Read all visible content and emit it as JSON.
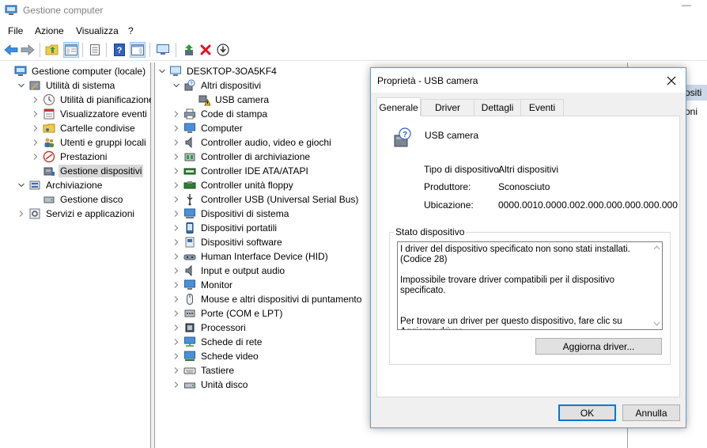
{
  "window": {
    "title": "Gestione computer",
    "minimize_glyph": "—"
  },
  "menu": [
    "File",
    "Azione",
    "Visualizza",
    "?"
  ],
  "toolbar_icons": [
    "back-arrow-icon",
    "forward-arrow-icon",
    "up-folder-icon",
    "show-hide-tree-icon",
    "properties-icon",
    "help-icon",
    "action-pane-icon",
    "monitor-icon",
    "update-driver-icon",
    "uninstall-icon",
    "download-icon"
  ],
  "left_tree": [
    {
      "label": "Gestione computer (locale)",
      "level": 0,
      "arrow": "none",
      "icon": "computer-management-icon"
    },
    {
      "label": "Utilità di sistema",
      "level": 1,
      "arrow": "down",
      "icon": "system-tools-icon"
    },
    {
      "label": "Utilità di pianificazione",
      "level": 2,
      "arrow": "right",
      "icon": "clock-icon"
    },
    {
      "label": "Visualizzatore eventi",
      "level": 2,
      "arrow": "right",
      "icon": "event-viewer-icon"
    },
    {
      "label": "Cartelle condivise",
      "level": 2,
      "arrow": "right",
      "icon": "shared-folder-icon"
    },
    {
      "label": "Utenti e gruppi locali",
      "level": 2,
      "arrow": "right",
      "icon": "users-icon"
    },
    {
      "label": "Prestazioni",
      "level": 2,
      "arrow": "right",
      "icon": "performance-icon"
    },
    {
      "label": "Gestione dispositivi",
      "level": 2,
      "arrow": "none",
      "icon": "device-manager-icon",
      "selected": true
    },
    {
      "label": "Archiviazione",
      "level": 1,
      "arrow": "down",
      "icon": "storage-icon"
    },
    {
      "label": "Gestione disco",
      "level": 2,
      "arrow": "none",
      "icon": "disk-icon"
    },
    {
      "label": "Servizi e applicazioni",
      "level": 1,
      "arrow": "right",
      "icon": "services-icon"
    }
  ],
  "device_tree": [
    {
      "label": "DESKTOP-3OA5KF4",
      "level": 0,
      "arrow": "down",
      "icon": "computer-icon"
    },
    {
      "label": "Altri dispositivi",
      "level": 1,
      "arrow": "down",
      "icon": "unknown-device-icon"
    },
    {
      "label": "USB camera",
      "level": 2,
      "arrow": "none",
      "icon": "warning-device-icon"
    },
    {
      "label": "Code di stampa",
      "level": 1,
      "arrow": "right",
      "icon": "printer-icon"
    },
    {
      "label": "Computer",
      "level": 1,
      "arrow": "right",
      "icon": "monitor-icon"
    },
    {
      "label": "Controller audio, video e giochi",
      "level": 1,
      "arrow": "right",
      "icon": "speaker-icon"
    },
    {
      "label": "Controller di archiviazione",
      "level": 1,
      "arrow": "right",
      "icon": "storage-controller-icon"
    },
    {
      "label": "Controller IDE ATA/ATAPI",
      "level": 1,
      "arrow": "right",
      "icon": "ide-controller-icon"
    },
    {
      "label": "Controller unità floppy",
      "level": 1,
      "arrow": "right",
      "icon": "floppy-controller-icon"
    },
    {
      "label": "Controller USB (Universal Serial Bus)",
      "level": 1,
      "arrow": "right",
      "icon": "usb-icon"
    },
    {
      "label": "Dispositivi di sistema",
      "level": 1,
      "arrow": "right",
      "icon": "system-device-icon"
    },
    {
      "label": "Dispositivi portatili",
      "level": 1,
      "arrow": "right",
      "icon": "portable-device-icon"
    },
    {
      "label": "Dispositivi software",
      "level": 1,
      "arrow": "right",
      "icon": "software-device-icon"
    },
    {
      "label": "Human Interface Device (HID)",
      "level": 1,
      "arrow": "right",
      "icon": "hid-icon"
    },
    {
      "label": "Input e output audio",
      "level": 1,
      "arrow": "right",
      "icon": "speaker-icon"
    },
    {
      "label": "Monitor",
      "level": 1,
      "arrow": "right",
      "icon": "monitor-icon"
    },
    {
      "label": "Mouse e altri dispositivi di puntamento",
      "level": 1,
      "arrow": "right",
      "icon": "mouse-icon"
    },
    {
      "label": "Porte (COM e LPT)",
      "level": 1,
      "arrow": "right",
      "icon": "port-icon"
    },
    {
      "label": "Processori",
      "level": 1,
      "arrow": "right",
      "icon": "processor-icon"
    },
    {
      "label": "Schede di rete",
      "level": 1,
      "arrow": "right",
      "icon": "network-adapter-icon"
    },
    {
      "label": "Schede video",
      "level": 1,
      "arrow": "right",
      "icon": "display-adapter-icon"
    },
    {
      "label": "Tastiere",
      "level": 1,
      "arrow": "right",
      "icon": "keyboard-icon"
    },
    {
      "label": "Unità disco",
      "level": 1,
      "arrow": "right",
      "icon": "disk-drive-icon"
    }
  ],
  "right_pane": {
    "partial_text_1": "ositi",
    "partial_text_2": "oni"
  },
  "dialog": {
    "title": "Proprietà - USB camera",
    "tabs": [
      "Generale",
      "Driver",
      "Dettagli",
      "Eventi"
    ],
    "device_name": "USB camera",
    "properties": [
      {
        "label": "Tipo di dispositivo:",
        "value": "Altri dispositivi"
      },
      {
        "label": "Produttore:",
        "value": "Sconosciuto"
      },
      {
        "label": "Ubicazione:",
        "value": "0000.0010.0000.002.000.000.000.000.000"
      }
    ],
    "status_group_label": "Stato dispositivo",
    "status_text": "I driver del dispositivo specificato non sono stati installati. (Codice 28)\n\nImpossibile trovare driver compatibili per il dispositivo specificato.\n\n\nPer trovare un driver per questo dispositivo, fare clic su Aggiorna driver.",
    "update_driver_label": "Aggiorna driver...",
    "ok_label": "OK",
    "cancel_label": "Annulla"
  },
  "colors": {
    "selection": "#d9d9d9",
    "dialog_border": "#5b9bd5",
    "default_button": "#0078d7",
    "error_red": "#e81123"
  }
}
